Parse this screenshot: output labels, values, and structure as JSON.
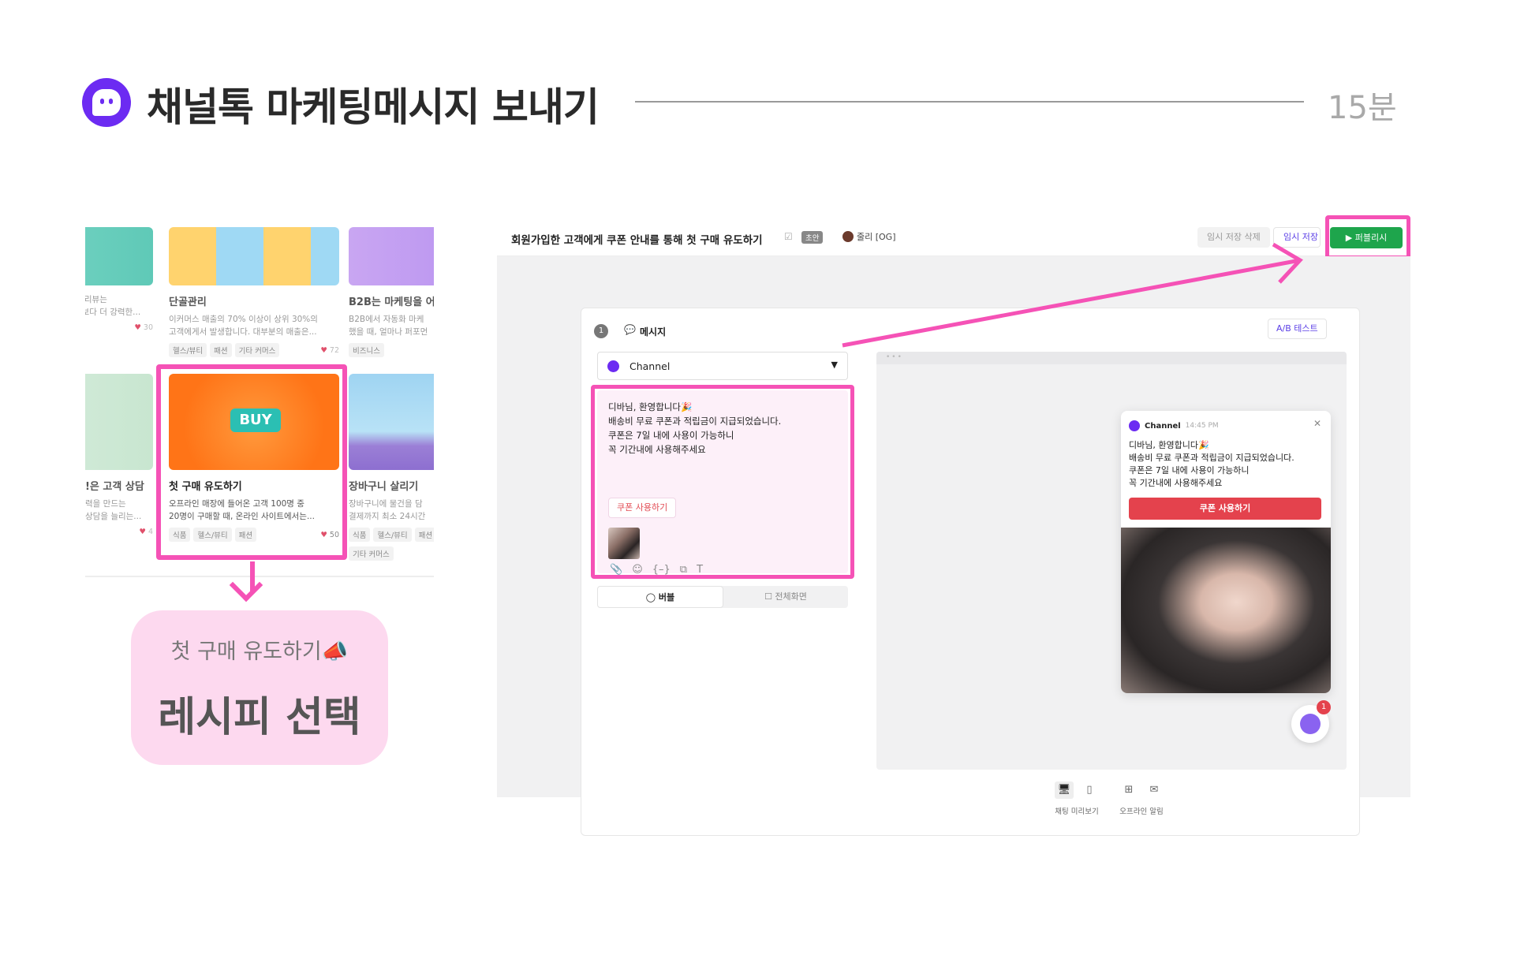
{
  "slide": {
    "title": "채널톡 마케팅메시지 보내기",
    "duration": "15분"
  },
  "gallery": {
    "cards": [
      {
        "title": "",
        "desc1": ": 리뷰는",
        "desc2": "|보다 더 강력한...",
        "tags": [],
        "likes": "30",
        "colors": [
          "#7dd8c8",
          "#5fc9b7"
        ]
      },
      {
        "title": "단골관리",
        "desc1": "이커머스 매출의 70% 이상이 상위 30%의",
        "desc2": "고객에게서 발생합니다. 대부분의 매출은...",
        "tags": [
          "헬스/뷰티",
          "패션",
          "기타 커머스"
        ],
        "likes": "72",
        "colors": [
          "#ffd36e",
          "#9fd9f4"
        ]
      },
      {
        "title": "B2B는 마케팅을 어",
        "desc1": "B2B에서 자동화 마케",
        "desc2": "했을 때, 얼마나 퍼포먼",
        "tags": [
          "비즈니스"
        ],
        "likes": "",
        "colors": [
          "#c9a6f2",
          "#b48ef0"
        ]
      },
      {
        "title": "!은 고객 상담",
        "desc1": "력을 만드는",
        "desc2": "상담을 늘리는...",
        "tags": [],
        "likes": "4",
        "colors": [
          "#d9eedf",
          "#c8e6d0"
        ]
      },
      {
        "title": "첫 구매 유도하기",
        "desc1": "오프라인 매장에 들어온 고객 100명 중",
        "desc2": "20명이 구매할 때, 온라인 사이트에서는...",
        "tags": [
          "식품",
          "헬스/뷰티",
          "패션"
        ],
        "likes": "50",
        "colors": [
          "#ff8a2a",
          "#ff7417"
        ],
        "buy_label": "BUY"
      },
      {
        "title": "장바구니 살리기",
        "desc1": "장바구니에 물건을 담",
        "desc2": "결제까지 최소 24시간",
        "tags": [
          "식품",
          "헬스/뷰티",
          "패션",
          "기타 커머스"
        ],
        "likes": "",
        "colors": [
          "#9fd4f2",
          "#9b7fd6"
        ]
      }
    ]
  },
  "recipe_bubble": {
    "sub": "첫 구매 유도하기📣",
    "main": "레시피 선택"
  },
  "app": {
    "title": "회원가입한 고객에게 쿠폰 안내를 통해 첫 구매 유도하기",
    "edit_icon": "☑",
    "draft_badge": "초안",
    "author": "줄리 [OG]",
    "btn_delete_draft": "임시 저장 삭제",
    "btn_save_draft": "임시 저장",
    "btn_publish": "▶ 퍼블리시",
    "step": {
      "num": "1",
      "icon": "💬",
      "label": "메시지"
    },
    "ab_test": "A/B 테스트",
    "channel_select": {
      "value": "Channel",
      "caret": "▼"
    },
    "composer": {
      "lines": [
        "디바님, 환영합니다🎉",
        "배송비 무료 쿠폰과 적립금이 지급되었습니다.",
        "쿠폰은 7일 내에 사용이 가능하니",
        "꼭 기간내에 사용해주세요"
      ],
      "coupon_button": "쿠폰 사용하기",
      "tool_icons": [
        "📎",
        "☺",
        "{–}",
        "⧉",
        "T"
      ]
    },
    "mode_tabs": [
      {
        "label": "◯ 버블",
        "active": true
      },
      {
        "label": "☐ 전체화면",
        "active": false
      }
    ],
    "preview": {
      "dots": "•••",
      "channel_name": "Channel",
      "time": "14:45 PM",
      "close": "✕",
      "lines": [
        "디바님, 환영합니다🎉",
        "배송비 무료 쿠폰과 적립금이 지급되었습니다.",
        "쿠폰은 7일 내에 사용이 가능하니",
        "꼭 기간내에 사용해주세요"
      ],
      "coupon_button": "쿠폰 사용하기",
      "launcher_badge": "1"
    },
    "preview_switch": [
      {
        "label": "채팅 미리보기",
        "icons": [
          "🖥",
          "▯"
        ]
      },
      {
        "label": "오프라인 알림",
        "icons": [
          "⊞",
          "✉"
        ]
      }
    ]
  },
  "colors": {
    "highlight": "#f552b6",
    "brand": "#6c2bf2",
    "publish": "#1ea54c",
    "coupon_red": "#e4424d"
  }
}
